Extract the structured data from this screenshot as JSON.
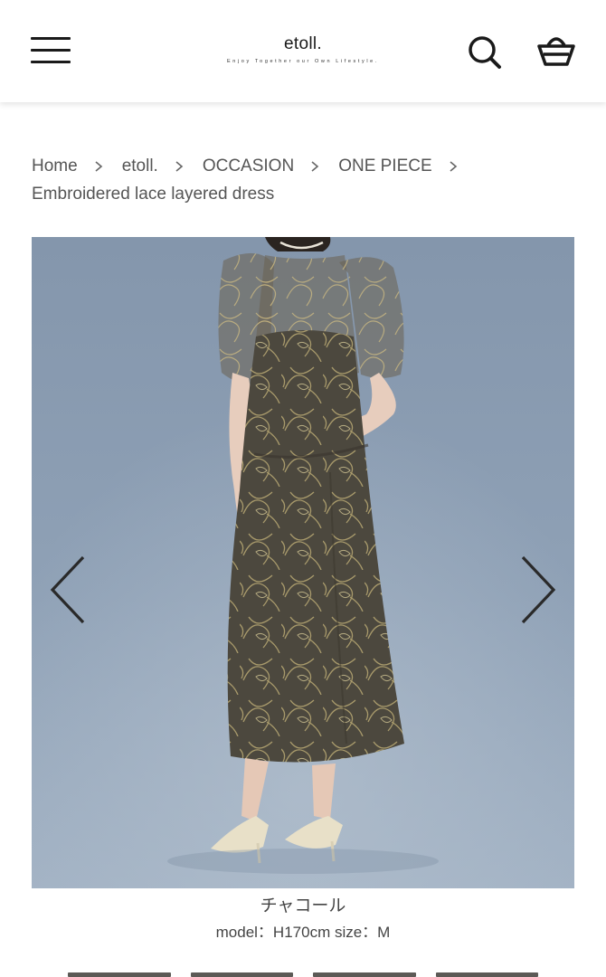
{
  "header": {
    "brand": "etoll.",
    "tagline": "Enjoy Together our Own Lifestyle.",
    "menu_icon": "hamburger-menu-icon",
    "search_icon": "search-icon",
    "cart_icon": "basket-icon"
  },
  "breadcrumb": {
    "items": [
      "Home",
      "etoll.",
      "OCCASION",
      "ONE PIECE"
    ],
    "current": "Embroidered lace layered dress"
  },
  "gallery": {
    "prev_icon": "chevron-left-icon",
    "next_icon": "chevron-right-icon",
    "background_color": "#8e9fb4",
    "dress_color": "#4e4a40"
  },
  "product": {
    "color_name": "チャコール",
    "model_info": "model：H170cm size：M"
  }
}
